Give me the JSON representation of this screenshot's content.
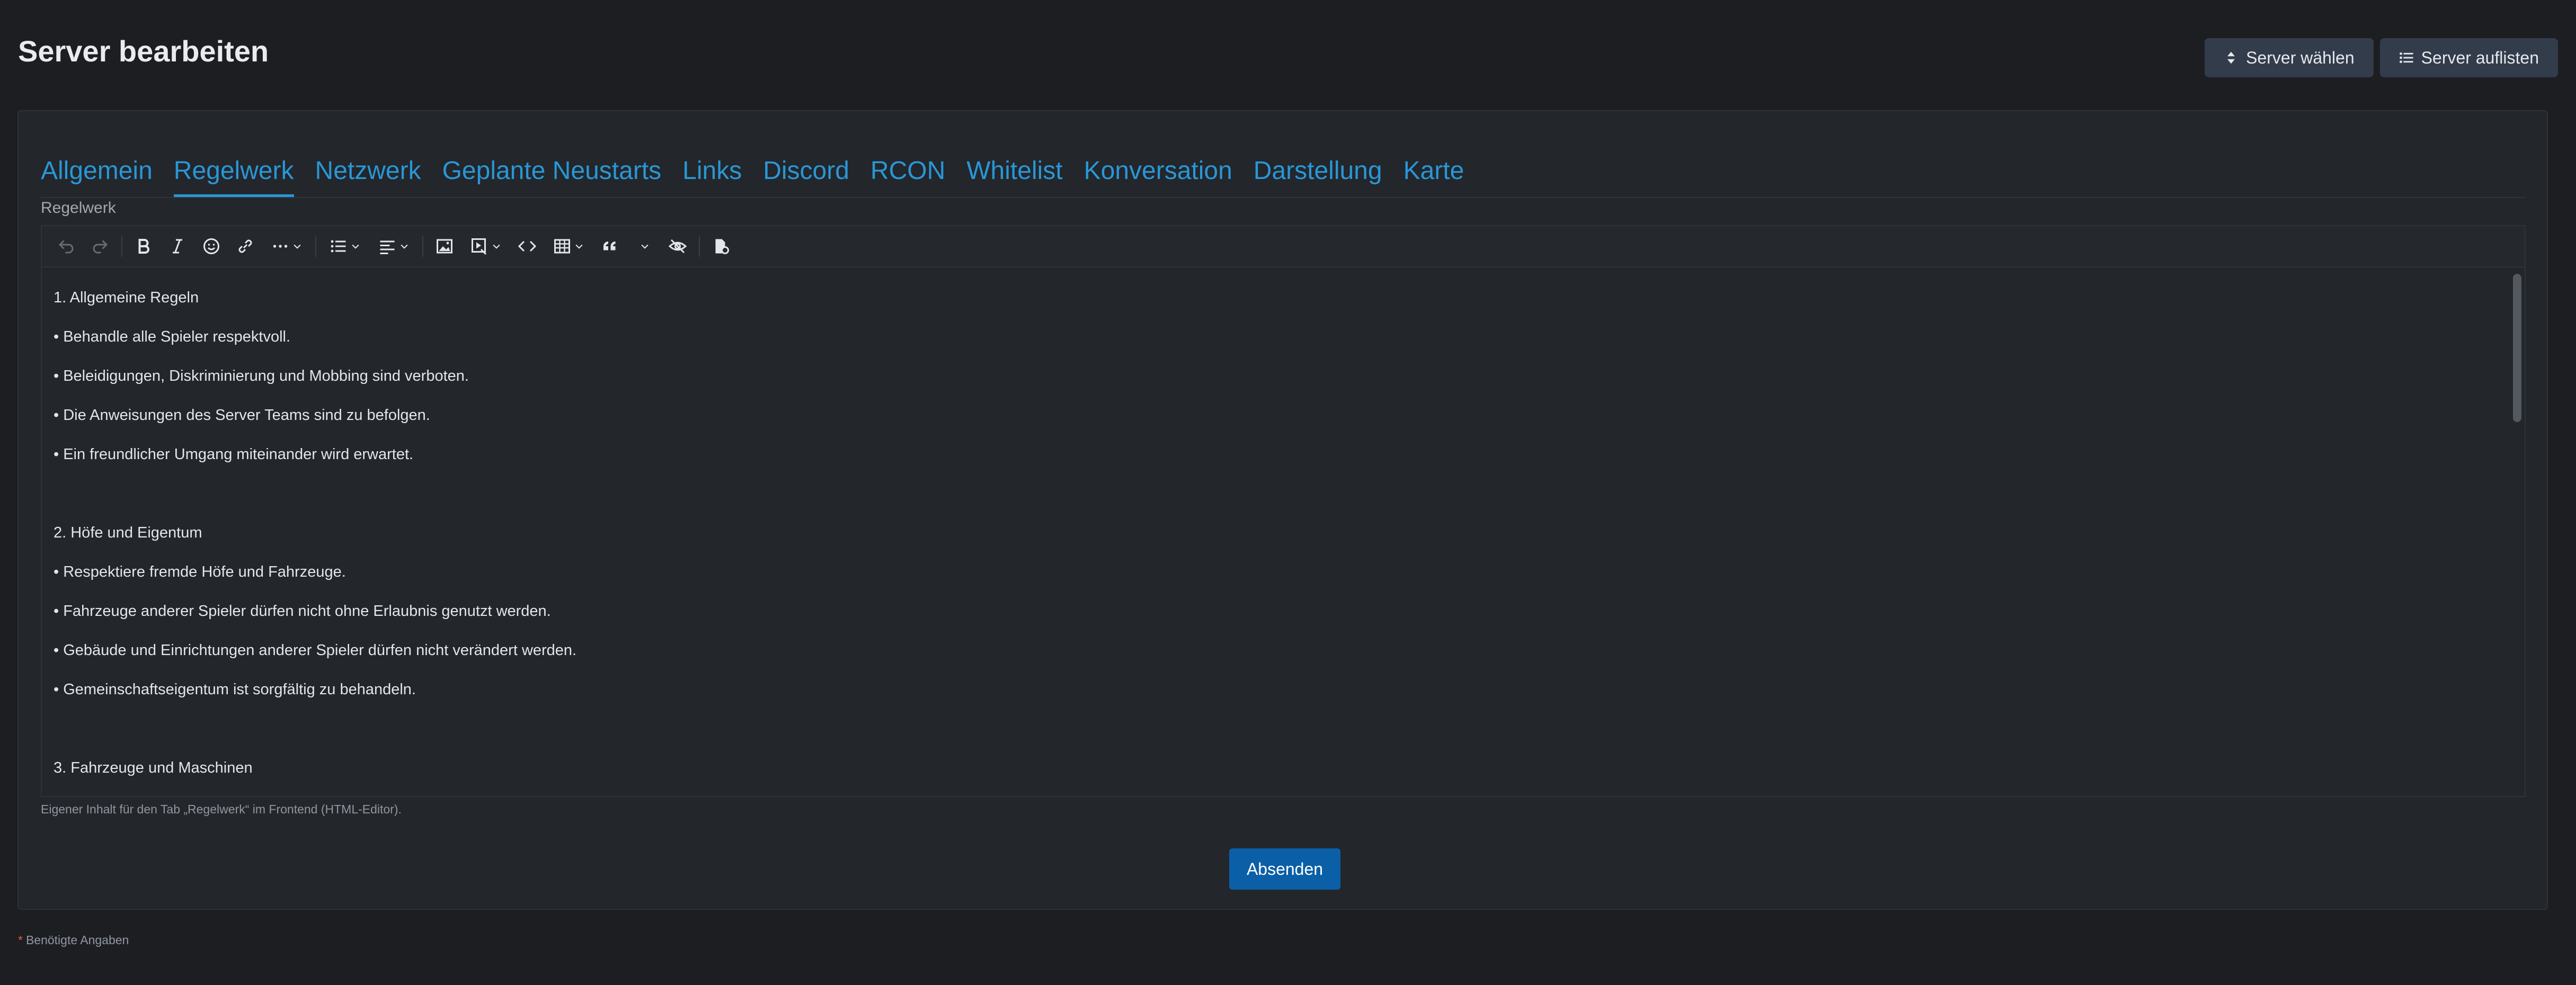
{
  "page": {
    "title": "Server bearbeiten"
  },
  "actions": {
    "choose_server": "Server wählen",
    "list_servers": "Server auflisten"
  },
  "tabs": [
    {
      "label": "Allgemein",
      "active": false
    },
    {
      "label": "Regelwerk",
      "active": true
    },
    {
      "label": "Netzwerk",
      "active": false
    },
    {
      "label": "Geplante Neustarts",
      "active": false
    },
    {
      "label": "Links",
      "active": false
    },
    {
      "label": "Discord",
      "active": false
    },
    {
      "label": "RCON",
      "active": false
    },
    {
      "label": "Whitelist",
      "active": false
    },
    {
      "label": "Konversation",
      "active": false
    },
    {
      "label": "Darstellung",
      "active": false
    },
    {
      "label": "Karte",
      "active": false
    }
  ],
  "field": {
    "label": "Regelwerk",
    "helper": "Eigener Inhalt für den Tab „Regelwerk“ im Frontend (HTML-Editor)."
  },
  "toolbar_icons": [
    "undo-icon",
    "redo-icon",
    "bold-icon",
    "italic-icon",
    "emoji-icon",
    "link-icon",
    "more-icon",
    "list-icon",
    "align-icon",
    "image-icon",
    "media-icon",
    "code-icon",
    "table-icon",
    "quote-icon",
    "hide-icon",
    "template-icon"
  ],
  "editor": {
    "lines": [
      "1. Allgemeine Regeln",
      "• Behandle alle Spieler respektvoll.",
      "• Beleidigungen, Diskriminierung und Mobbing sind verboten.",
      "• Die Anweisungen des Server Teams sind zu befolgen.",
      "• Ein freundlicher Umgang miteinander wird erwartet.",
      "",
      "2. Höfe und Eigentum",
      "• Respektiere fremde Höfe und Fahrzeuge.",
      "• Fahrzeuge anderer Spieler dürfen nicht ohne Erlaubnis genutzt werden.",
      "• Gebäude und Einrichtungen anderer Spieler dürfen nicht verändert werden.",
      "• Gemeinschaftseigentum ist sorgfältig zu behandeln.",
      "",
      "3. Fahrzeuge und Maschinen"
    ]
  },
  "form": {
    "submit": "Absenden",
    "required_note": "Benötigte Angaben",
    "required_marker": "*"
  },
  "colors": {
    "accent": "#2997d6",
    "submit": "#0b5fa6",
    "background": "#1c1e22",
    "panel": "#23262b",
    "required": "#e05b4b"
  }
}
